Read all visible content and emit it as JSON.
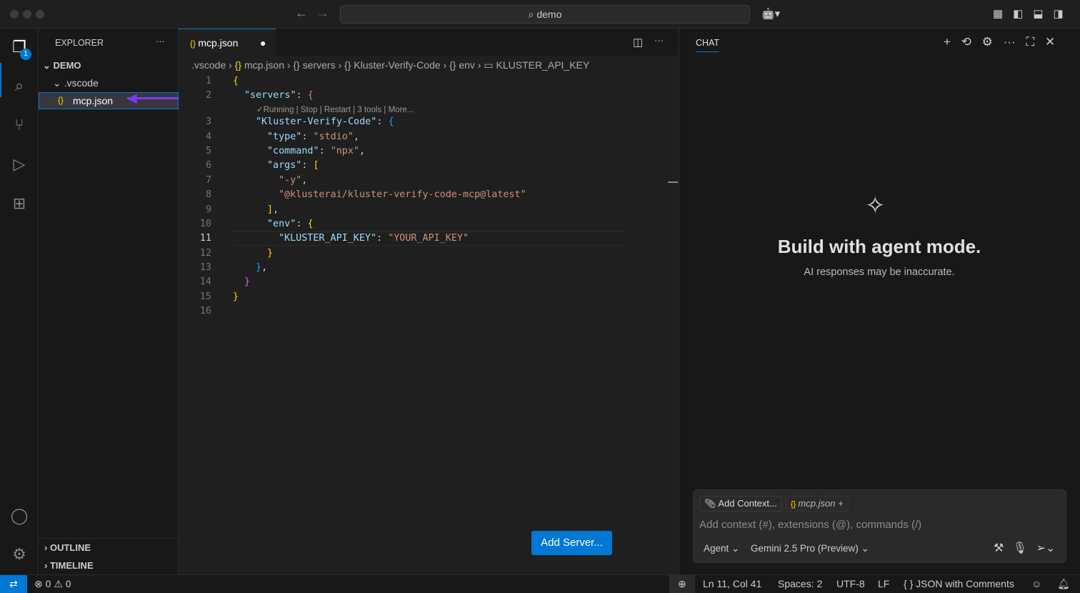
{
  "titlebar": {
    "search": "demo"
  },
  "activity": {
    "explorer_badge": "1"
  },
  "sidebar": {
    "title": "EXPLORER",
    "root": "DEMO",
    "folder": ".vscode",
    "file": "mcp.json",
    "outline": "OUTLINE",
    "timeline": "TIMELINE"
  },
  "editor": {
    "tab": "mcp.json",
    "breadcrumb": [
      ".vscode",
      "mcp.json",
      "servers",
      "Kluster-Verify-Code",
      "env",
      "KLUSTER_API_KEY"
    ],
    "codelens": "✓Running | Stop | Restart | 3 tools | More...",
    "add_server": "Add Server...",
    "lines": [
      "1",
      "2",
      "3",
      "4",
      "5",
      "6",
      "7",
      "8",
      "9",
      "10",
      "11",
      "12",
      "13",
      "14",
      "15",
      "16"
    ],
    "code": {
      "l2k": "\"servers\"",
      "l3k": "\"Kluster-Verify-Code\"",
      "l4k": "\"type\"",
      "l4v": "\"stdio\"",
      "l5k": "\"command\"",
      "l5v": "\"npx\"",
      "l6k": "\"args\"",
      "l7v": "\"-y\"",
      "l8v": "\"@klusterai/kluster-verify-code-mcp@latest\"",
      "l10k": "\"env\"",
      "l11k": "\"KLUSTER_API_KEY\"",
      "l11v": "\"YOUR_API_KEY\""
    }
  },
  "chat": {
    "title": "CHAT",
    "heading": "Build with agent mode.",
    "subtitle": "AI responses may be inaccurate.",
    "add_context": "Add Context...",
    "context_file": "mcp.json",
    "placeholder": "Add context (#), extensions (@), commands (/)",
    "mode": "Agent",
    "model": "Gemini 2.5 Pro (Preview)"
  },
  "status": {
    "errors": "0",
    "warnings": "0",
    "position": "Ln 11, Col 41",
    "spaces": "Spaces: 2",
    "encoding": "UTF-8",
    "eol": "LF",
    "language": "JSON with Comments"
  },
  "colors": {
    "accent": "#0078d4",
    "arrow": "#7c3aed"
  }
}
